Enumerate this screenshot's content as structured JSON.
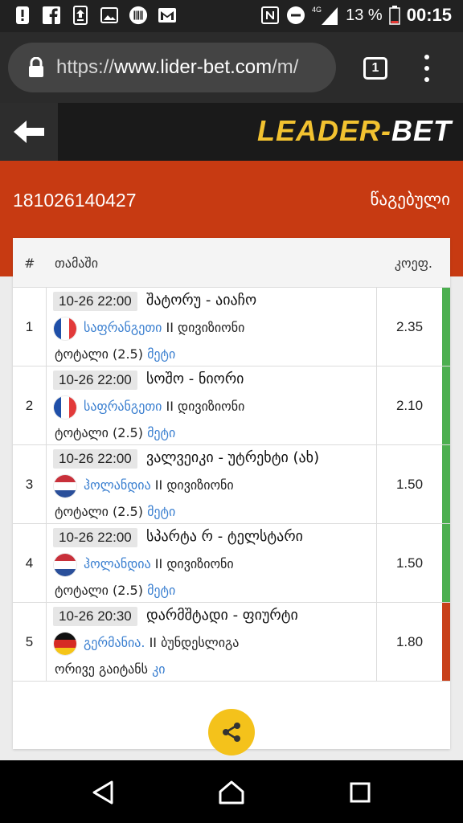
{
  "status_bar": {
    "battery": "13 %",
    "network": "4G",
    "time": "00:15",
    "icons": [
      "alert-icon",
      "facebook-icon",
      "upload-icon",
      "image-icon",
      "barcode-icon",
      "gmail-icon",
      "nfc-icon",
      "dnd-icon",
      "signal-icon",
      "battery-icon"
    ]
  },
  "browser": {
    "url_prefix": "https://",
    "url_host": "www.lider-bet.com",
    "url_suffix": "/m/",
    "tab_count": "1"
  },
  "site": {
    "logo_part1": "LEADER",
    "logo_sep": "-",
    "logo_part2": "BET"
  },
  "ticket": {
    "id": "181026140427",
    "status": "წაგებული"
  },
  "table": {
    "headers": {
      "num": "#",
      "game": "თამაში",
      "odds": "კოეფ."
    },
    "rows": [
      {
        "num": "1",
        "datetime": "10-26 22:00",
        "match": "შატორუ - აიაჩო",
        "country": "საფრანგეთი",
        "league": " II დივიზიონი",
        "market": "ტოტალი (2.5)",
        "pick": "მეტი",
        "odds": "2.35",
        "flag": "france",
        "result_color": "#4caf50"
      },
      {
        "num": "2",
        "datetime": "10-26 22:00",
        "match": "სოშო - ნიორი",
        "country": "საფრანგეთი",
        "league": " II დივიზიონი",
        "market": "ტოტალი (2.5)",
        "pick": "მეტი",
        "odds": "2.10",
        "flag": "france",
        "result_color": "#4caf50"
      },
      {
        "num": "3",
        "datetime": "10-26 22:00",
        "match": "ვალვეიკი - უტრეხტი (ახ)",
        "country": "ჰოლანდია",
        "league": " II დივიზიონი",
        "market": "ტოტალი (2.5)",
        "pick": "მეტი",
        "odds": "1.50",
        "flag": "netherlands",
        "result_color": "#4caf50"
      },
      {
        "num": "4",
        "datetime": "10-26 22:00",
        "match": "სპარტა რ - ტელსტარი",
        "country": "ჰოლანდია",
        "league": " II დივიზიონი",
        "market": "ტოტალი (2.5)",
        "pick": "მეტი",
        "odds": "1.50",
        "flag": "netherlands",
        "result_color": "#4caf50"
      },
      {
        "num": "5",
        "datetime": "10-26 20:30",
        "match": "დარმშტადი - ფიურტი",
        "country": "გერმანია.",
        "league": " II ბუნდესლიგა",
        "market": "ორივე გაიტანს",
        "pick": "კი",
        "odds": "1.80",
        "flag": "germany",
        "result_color": "#c8401a"
      }
    ]
  },
  "colors": {
    "brand_orange": "#c73a12",
    "logo_yellow": "#f2c230",
    "link_blue": "#3a7fd0",
    "win_green": "#4caf50",
    "lose_red": "#c8401a",
    "share_yellow": "#f4c21b"
  }
}
